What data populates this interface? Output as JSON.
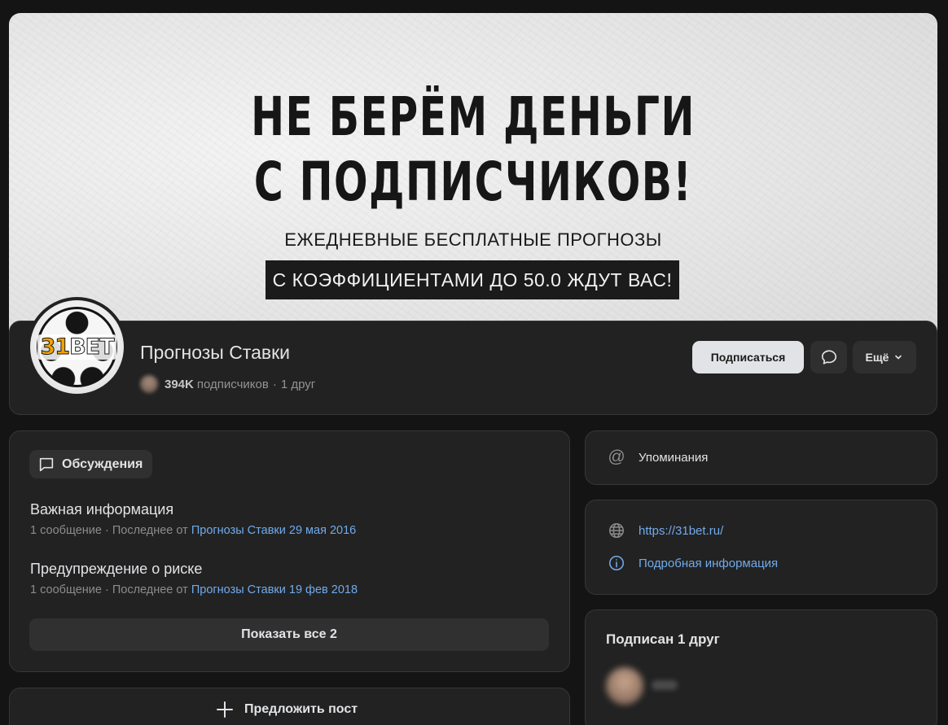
{
  "cover": {
    "headline_line1": "НЕ БЕРЁМ ДЕНЬГИ",
    "headline_line2": "С ПОДПИСЧИКОВ!",
    "subline": "ЕЖЕДНЕВНЫЕ БЕСПЛАТНЫЕ ПРОГНОЗЫ",
    "pill": "С КОЭФФИЦИЕНТАМИ ДО 50.0 ЖДУТ ВАС!"
  },
  "profile": {
    "avatar_logo_number": "31",
    "avatar_logo_text": "BET",
    "name": "Прогнозы Ставки",
    "subscribers_count": "394K",
    "subscribers_label": "подписчиков",
    "separator": "·",
    "friends_text": "1 друг"
  },
  "actions": {
    "subscribe": "Подписаться",
    "more": "Ещё"
  },
  "discussions": {
    "tag_label": "Обсуждения",
    "topics": [
      {
        "title": "Важная информация",
        "meta_prefix": "1 сообщение · Последнее от",
        "author": "Прогнозы Ставки",
        "date": "29 мая 2016"
      },
      {
        "title": "Предупреждение о риске",
        "meta_prefix": "1 сообщение · Последнее от",
        "author": "Прогнозы Ставки",
        "date": "19 фев 2018"
      }
    ],
    "show_all": "Показать все 2"
  },
  "suggest_post": "Предложить пост",
  "sidebar": {
    "mentions": "Упоминания",
    "website": "https://31bet.ru/",
    "details": "Подробная информация",
    "friends_title": "Подписан 1 друг"
  },
  "colors": {
    "background": "#141414",
    "card": "#222222",
    "link": "#71aaeb",
    "primary_button": "#e1e3e6"
  },
  "icons": [
    "chat-bubble-icon",
    "chevron-down-icon",
    "plus-icon",
    "at-icon",
    "globe-icon",
    "info-icon"
  ]
}
